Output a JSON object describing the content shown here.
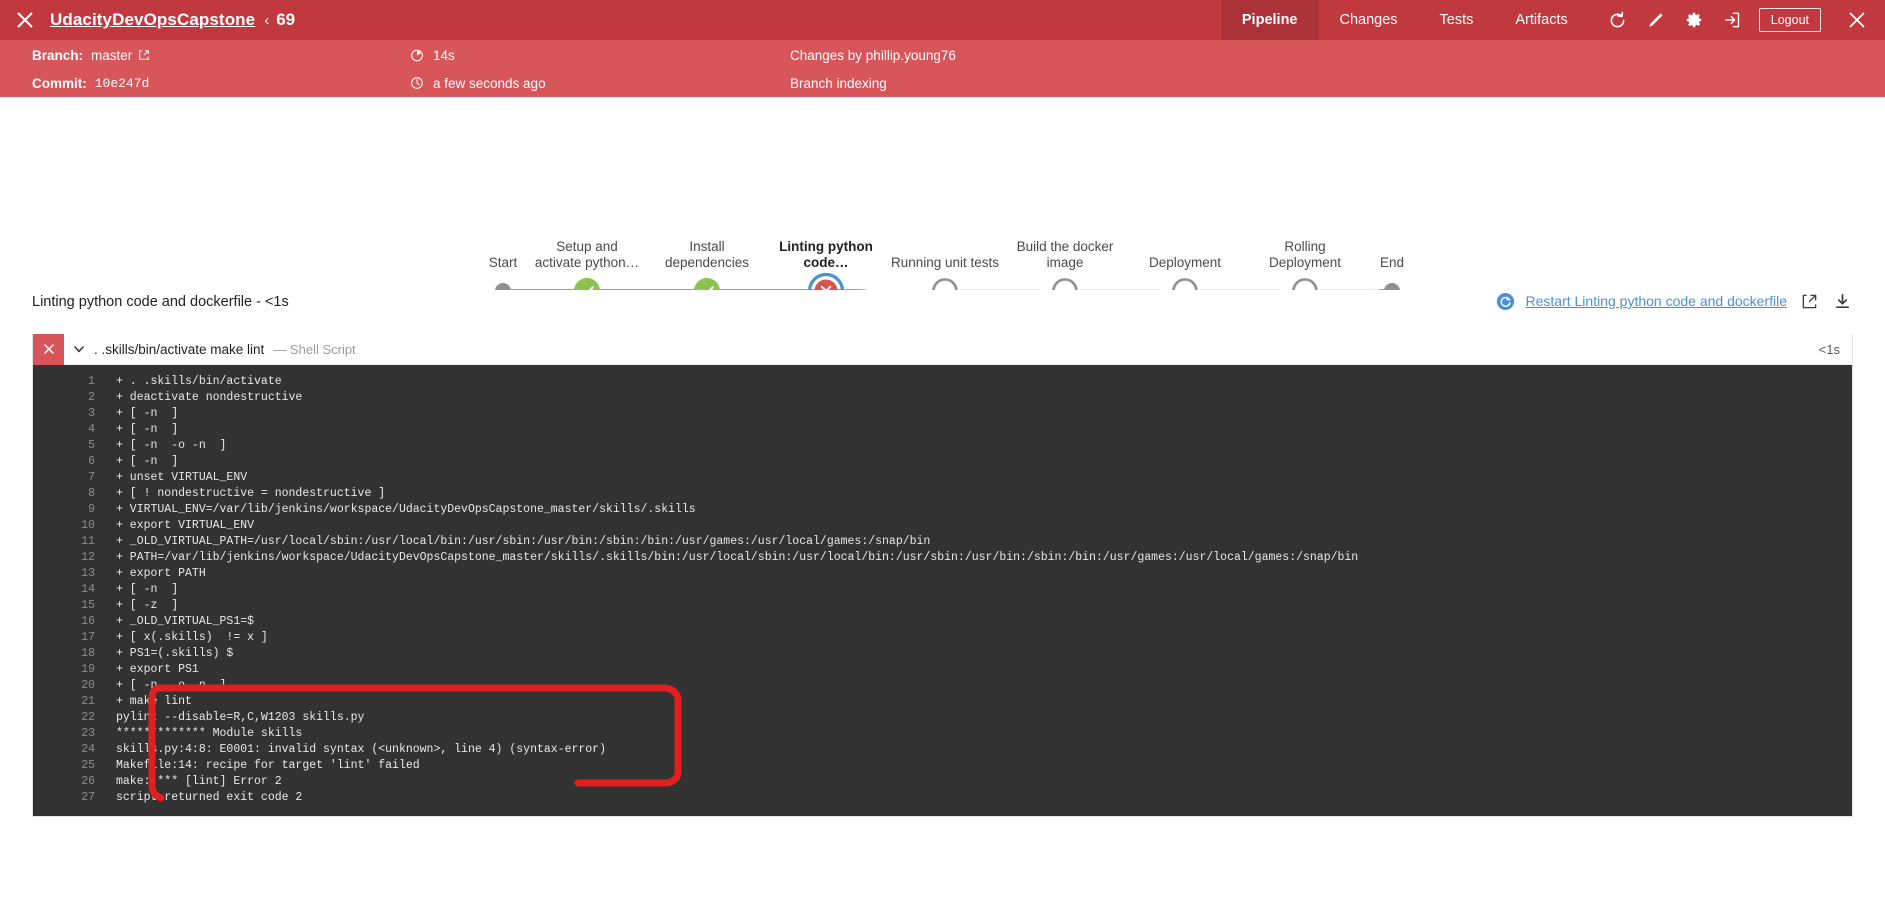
{
  "topbar": {
    "close_icon": "close-x-icon",
    "project_title": "UdacityDevOpsCapstone",
    "chevron": "‹",
    "run_number": "69",
    "nav": [
      {
        "label": "Pipeline",
        "active": true
      },
      {
        "label": "Changes",
        "active": false
      },
      {
        "label": "Tests",
        "active": false
      },
      {
        "label": "Artifacts",
        "active": false
      }
    ],
    "icons": [
      "replay-icon",
      "edit-pencil-icon",
      "gear-icon",
      "logout-arrow-icon"
    ],
    "logout_label": "Logout",
    "close_right_icon": "close-x-icon",
    "bg_color": "#c1393f",
    "active_bg_color": "#ab3239"
  },
  "meta": {
    "branch_label": "Branch:",
    "branch_value": "master",
    "branch_external_icon": "external-link-icon",
    "commit_label": "Commit:",
    "commit_value": "10e247d",
    "duration_icon": "stopwatch-icon",
    "duration_value": "14s",
    "time_icon": "clock-icon",
    "time_value": "a few seconds ago",
    "changes_by": "Changes by phillip.young76",
    "cause": "Branch indexing",
    "bg_color": "#d8555a"
  },
  "pipeline": {
    "stages": [
      {
        "label": "Start",
        "status": "start",
        "selected": false
      },
      {
        "label": "Setup and\nactivate python…",
        "status": "success",
        "selected": false
      },
      {
        "label": "Install\ndependencies",
        "status": "success",
        "selected": false
      },
      {
        "label": "Linting python\ncode…",
        "status": "failed",
        "selected": true
      },
      {
        "label": "Running unit tests",
        "status": "pending",
        "selected": false
      },
      {
        "label": "Build the docker\nimage",
        "status": "pending",
        "selected": false
      },
      {
        "label": "Deployment",
        "status": "pending",
        "selected": false
      },
      {
        "label": "Rolling\nDeployment",
        "status": "pending",
        "selected": false
      },
      {
        "label": "End",
        "status": "end",
        "selected": false
      }
    ],
    "success_color": "#8cc04f",
    "failed_color": "#d9534f",
    "selected_ring_color": "#4a90d9",
    "pending_color": "#8e8e8e"
  },
  "log_header": {
    "title": "Linting python code and dockerfile - <1s",
    "restart_icon": "restart-circle-icon",
    "restart_link": "Restart Linting python code and dockerfile",
    "open_external_icon": "external-link-icon",
    "download_icon": "download-icon",
    "link_color": "#4a90d9"
  },
  "step": {
    "status_icon": "failed-x-icon",
    "caret_icon": "chevron-down-icon",
    "name": ". .skills/bin/activate make lint",
    "type": "— Shell Script",
    "duration": "<1s"
  },
  "console": {
    "lines": [
      {
        "n": "1",
        "text": "+ . .skills/bin/activate"
      },
      {
        "n": "2",
        "text": "+ deactivate nondestructive"
      },
      {
        "n": "3",
        "text": "+ [ -n  ]"
      },
      {
        "n": "4",
        "text": "+ [ -n  ]"
      },
      {
        "n": "5",
        "text": "+ [ -n  -o -n  ]"
      },
      {
        "n": "6",
        "text": "+ [ -n  ]"
      },
      {
        "n": "7",
        "text": "+ unset VIRTUAL_ENV"
      },
      {
        "n": "8",
        "text": "+ [ ! nondestructive = nondestructive ]"
      },
      {
        "n": "9",
        "text": "+ VIRTUAL_ENV=/var/lib/jenkins/workspace/UdacityDevOpsCapstone_master/skills/.skills"
      },
      {
        "n": "10",
        "text": "+ export VIRTUAL_ENV"
      },
      {
        "n": "11",
        "text": "+ _OLD_VIRTUAL_PATH=/usr/local/sbin:/usr/local/bin:/usr/sbin:/usr/bin:/sbin:/bin:/usr/games:/usr/local/games:/snap/bin"
      },
      {
        "n": "12",
        "text": "+ PATH=/var/lib/jenkins/workspace/UdacityDevOpsCapstone_master/skills/.skills/bin:/usr/local/sbin:/usr/local/bin:/usr/sbin:/usr/bin:/sbin:/bin:/usr/games:/usr/local/games:/snap/bin"
      },
      {
        "n": "13",
        "text": "+ export PATH"
      },
      {
        "n": "14",
        "text": "+ [ -n  ]"
      },
      {
        "n": "15",
        "text": "+ [ -z  ]"
      },
      {
        "n": "16",
        "text": "+ _OLD_VIRTUAL_PS1=$"
      },
      {
        "n": "17",
        "text": "+ [ x(.skills)  != x ]"
      },
      {
        "n": "18",
        "text": "+ PS1=(.skills) $"
      },
      {
        "n": "19",
        "text": "+ export PS1"
      },
      {
        "n": "20",
        "text": "+ [ -n  -o -n  ]"
      },
      {
        "n": "21",
        "text": "+ make lint"
      },
      {
        "n": "22",
        "text": "pylint --disable=R,C,W1203 skills.py"
      },
      {
        "n": "23",
        "text": "************* Module skills"
      },
      {
        "n": "24",
        "text": "skills.py:4:8: E0001: invalid syntax (<unknown>, line 4) (syntax-error)"
      },
      {
        "n": "25",
        "text": "Makefile:14: recipe for target 'lint' failed"
      },
      {
        "n": "26",
        "text": "make: *** [lint] Error 2"
      },
      {
        "n": "27",
        "text": "script returned exit code 2"
      }
    ],
    "bg_color": "#323232",
    "annotation_color": "#e02020"
  }
}
